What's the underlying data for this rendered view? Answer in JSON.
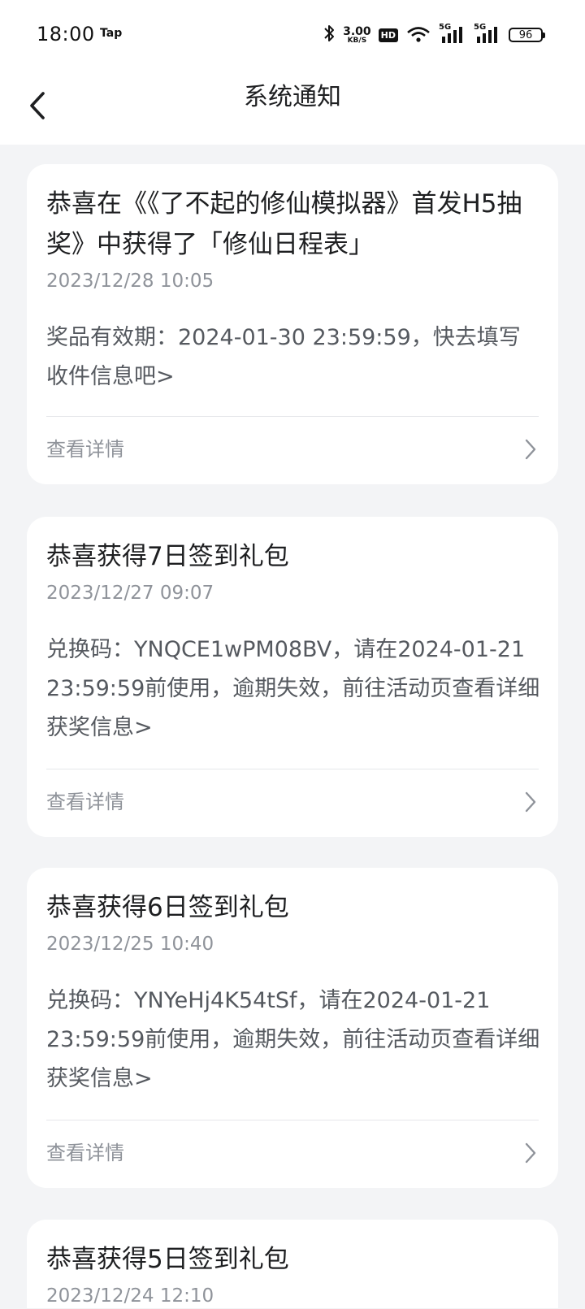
{
  "status_bar": {
    "time": "18:00",
    "app_indicator": "Tap",
    "network_speed_value": "3.00",
    "network_speed_unit": "KB/S",
    "hd_label": "HD",
    "signal_1_label": "5G",
    "signal_2_label": "5G",
    "battery_level": "96",
    "icons": [
      "bluetooth-icon",
      "hd-icon",
      "wifi-icon",
      "signal-icon",
      "signal-icon",
      "battery-icon"
    ]
  },
  "header": {
    "title": "系统通知",
    "back_icon": "chevron-left-icon"
  },
  "notifications": [
    {
      "title": "恭喜在《《了不起的修仙模拟器》首发H5抽奖》中获得了「修仙日程表」",
      "time": "2023/12/28 10:05",
      "body": "奖品有效期：2024-01-30 23:59:59，快去填写收件信息吧>",
      "detail_label": "查看详情"
    },
    {
      "title": "恭喜获得7日签到礼包",
      "time": "2023/12/27 09:07",
      "body": "兑换码：YNQCE1wPM08BV，请在2024-01-21 23:59:59前使用，逾期失效，前往活动页查看详细获奖信息>",
      "detail_label": "查看详情"
    },
    {
      "title": "恭喜获得6日签到礼包",
      "time": "2023/12/25 10:40",
      "body": "兑换码：YNYeHj4K54tSf，请在2024-01-21 23:59:59前使用，逾期失效，前往活动页查看详细获奖信息>",
      "detail_label": "查看详情"
    },
    {
      "title": "恭喜获得5日签到礼包",
      "time": "2023/12/24 12:10"
    }
  ],
  "colors": {
    "page_background": "#f3f4f6",
    "card_background": "#ffffff",
    "title_text": "#1e1f21",
    "secondary_text": "#8f939a",
    "body_text": "#55595f"
  }
}
